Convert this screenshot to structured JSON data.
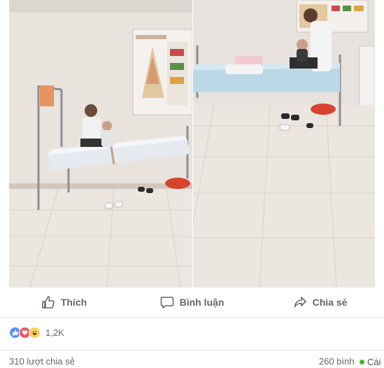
{
  "post": {
    "actions": {
      "like": "Thích",
      "comment": "Bình luận",
      "share": "Chia sẻ"
    },
    "reactions": {
      "types": [
        "like",
        "love",
        "haha"
      ],
      "count": "1,2K"
    },
    "shares": "310 lượt chia sẻ",
    "comments": "260 bình"
  },
  "chat": {
    "label": "Cái",
    "status_color": "#42b72a"
  },
  "colors": {
    "like": "#5890ff",
    "love": "#f25268",
    "haha": "#fcd15f",
    "action_text": "#616770"
  }
}
